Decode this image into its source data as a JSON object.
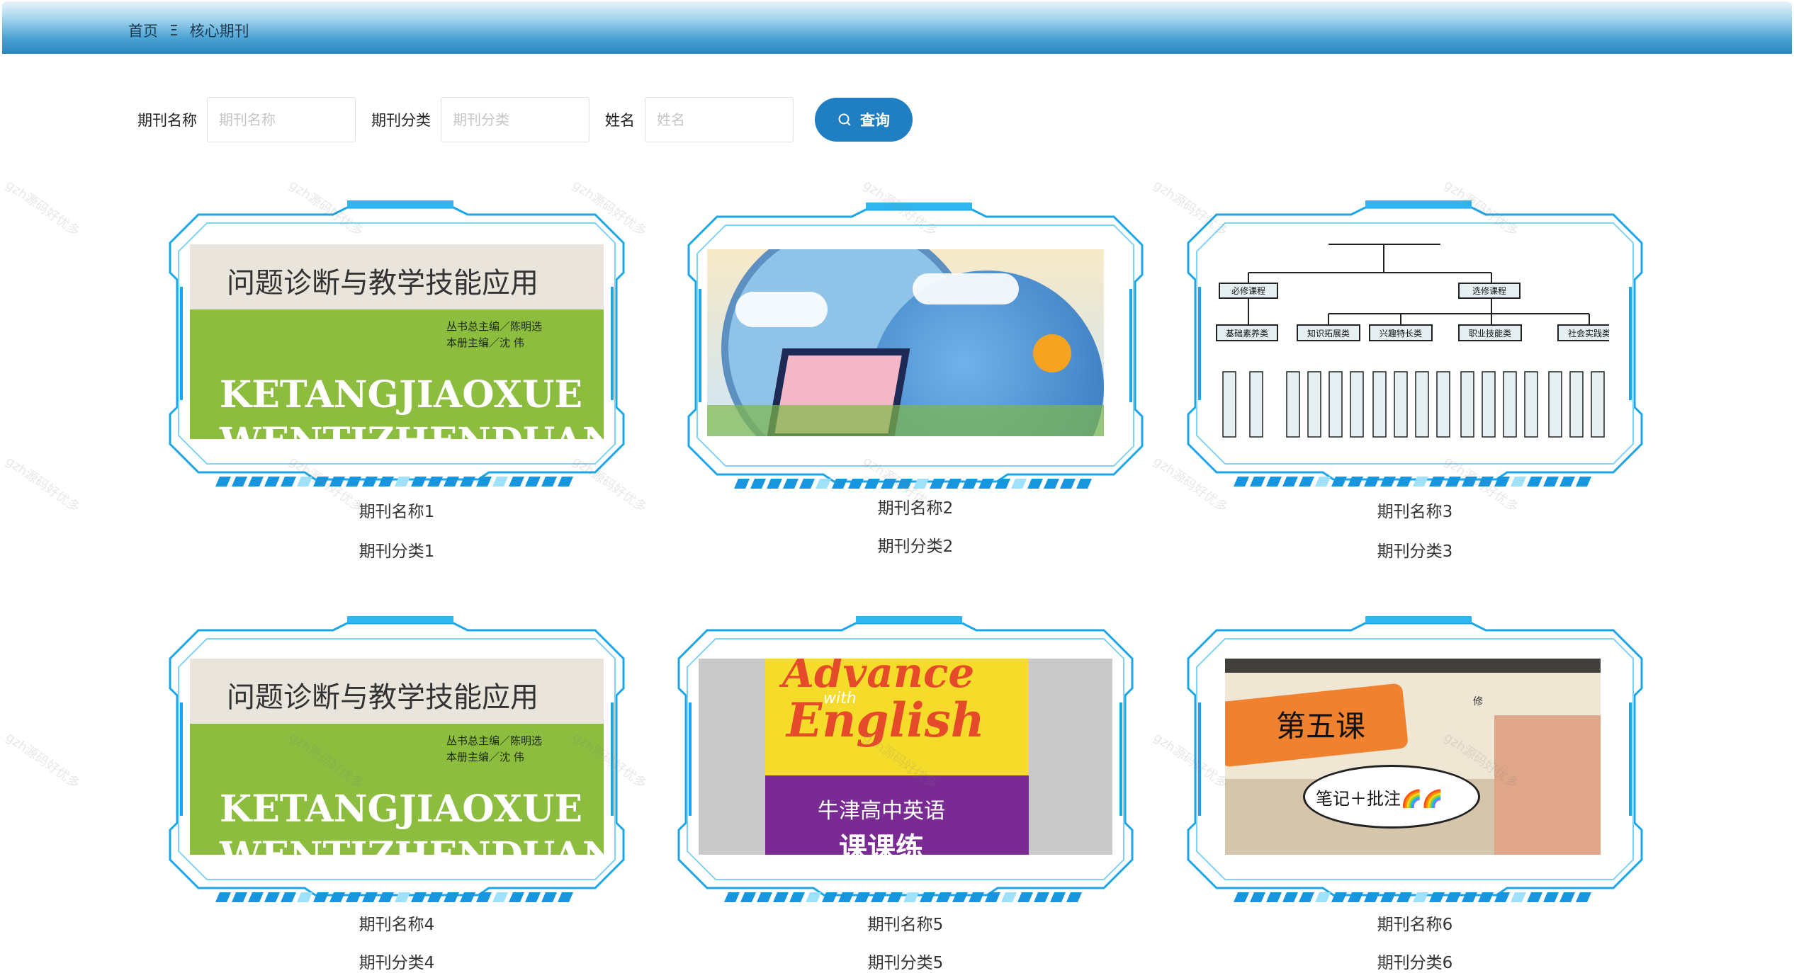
{
  "breadcrumb": {
    "home": "首页",
    "separator": "Ξ",
    "current": "核心期刊"
  },
  "search": {
    "fields": [
      {
        "label": "期刊名称",
        "placeholder": "期刊名称"
      },
      {
        "label": "期刊分类",
        "placeholder": "期刊分类"
      },
      {
        "label": "姓名",
        "placeholder": "姓名"
      }
    ],
    "button_label": "查询"
  },
  "watermark": "gzh源码好优多",
  "cards": [
    {
      "name": "期刊名称1",
      "category": "期刊分类1",
      "cover": {
        "title": "问题诊断与教学技能应用",
        "editor1": "丛书总主编／陈明选",
        "editor2": "本册主编／沈 伟",
        "pinyin": "KETANGJIAOXUE",
        "pinyin2": "WENTIZHENDUAN"
      }
    },
    {
      "name": "期刊名称2",
      "category": "期刊分类2",
      "cover": {
        "title": ""
      }
    },
    {
      "name": "期刊名称3",
      "category": "期刊分类3",
      "cover": {
        "top1": "必修课程",
        "top2": "选修课程",
        "mid": [
          "基础素养类",
          "知识拓展类",
          "兴趣特长类",
          "职业技能类",
          "社会实践类"
        ]
      }
    },
    {
      "name": "期刊名称4",
      "category": "期刊分类4",
      "cover": {
        "title": "问题诊断与教学技能应用",
        "editor1": "丛书总主编／陈明选",
        "editor2": "本册主编／沈 伟",
        "pinyin": "KETANGJIAOXUE",
        "pinyin2": "WENTIZHENDUAN"
      }
    },
    {
      "name": "期刊名称5",
      "category": "期刊分类5",
      "cover": {
        "title1": "Advance",
        "with": "with",
        "title2": "English",
        "sub1": "牛津高中英语",
        "sub2": "课课练"
      }
    },
    {
      "name": "期刊名称6",
      "category": "期刊分类6",
      "cover": {
        "title": "第五课",
        "note": "笔记＋批注🌈🌈",
        "small": "修"
      }
    }
  ]
}
